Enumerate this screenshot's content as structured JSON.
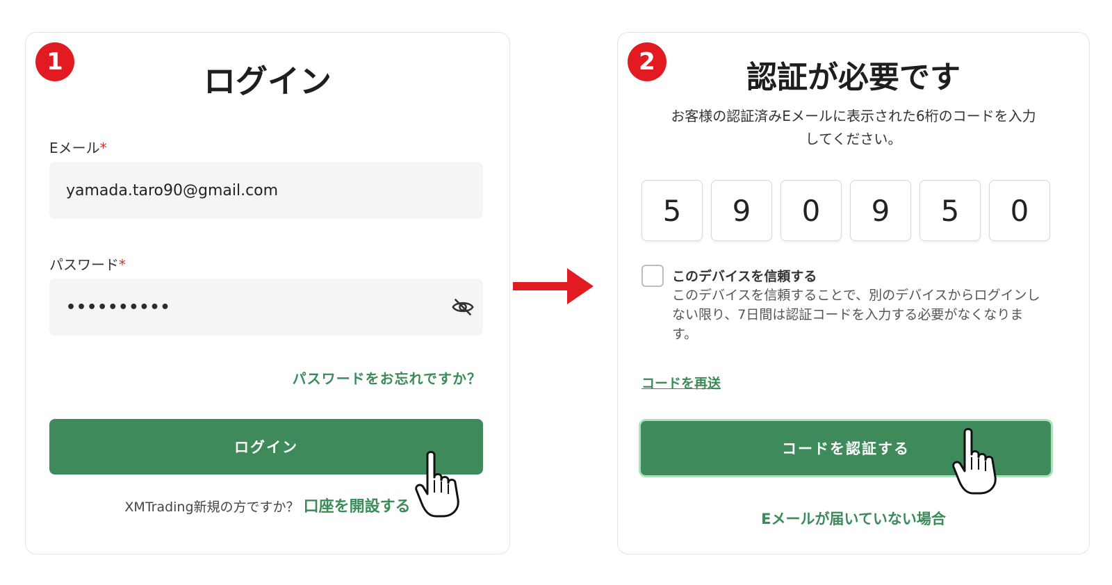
{
  "login_panel": {
    "step": "1",
    "title": "ログイン",
    "email_label": "Eメール",
    "email_required": "*",
    "email_value": "yamada.taro90@gmail.com",
    "password_label": "パスワード",
    "password_required": "*",
    "password_value": "••••••••••",
    "forgot_link": "パスワードをお忘れですか？",
    "login_button": "ログイン",
    "signup_prompt": "XMTrading新規の方ですか？",
    "signup_link": "口座を開設する"
  },
  "verify_panel": {
    "step": "2",
    "title": "認証が必要です",
    "instruction_line1": "お客様の認証済みEメールに表示された6桁のコードを入力",
    "instruction_line2": "してください。",
    "code_digits": [
      "5",
      "9",
      "0",
      "9",
      "5",
      "0"
    ],
    "trust_device_title": "このデバイスを信頼する",
    "trust_device_desc": "このデバイスを信頼することで、別のデバイスからログインしない限り、7日間は認証コードを入力する必要がなくなります。",
    "resend_link": "コードを再送",
    "verify_button": "コードを認証する",
    "no_email_link": "Eメールが届いていない場合"
  },
  "colors": {
    "brand_green": "#3e8a5b",
    "link_green": "#3b8a58",
    "badge_red": "#e21b23",
    "arrow_red": "#e21b23"
  }
}
